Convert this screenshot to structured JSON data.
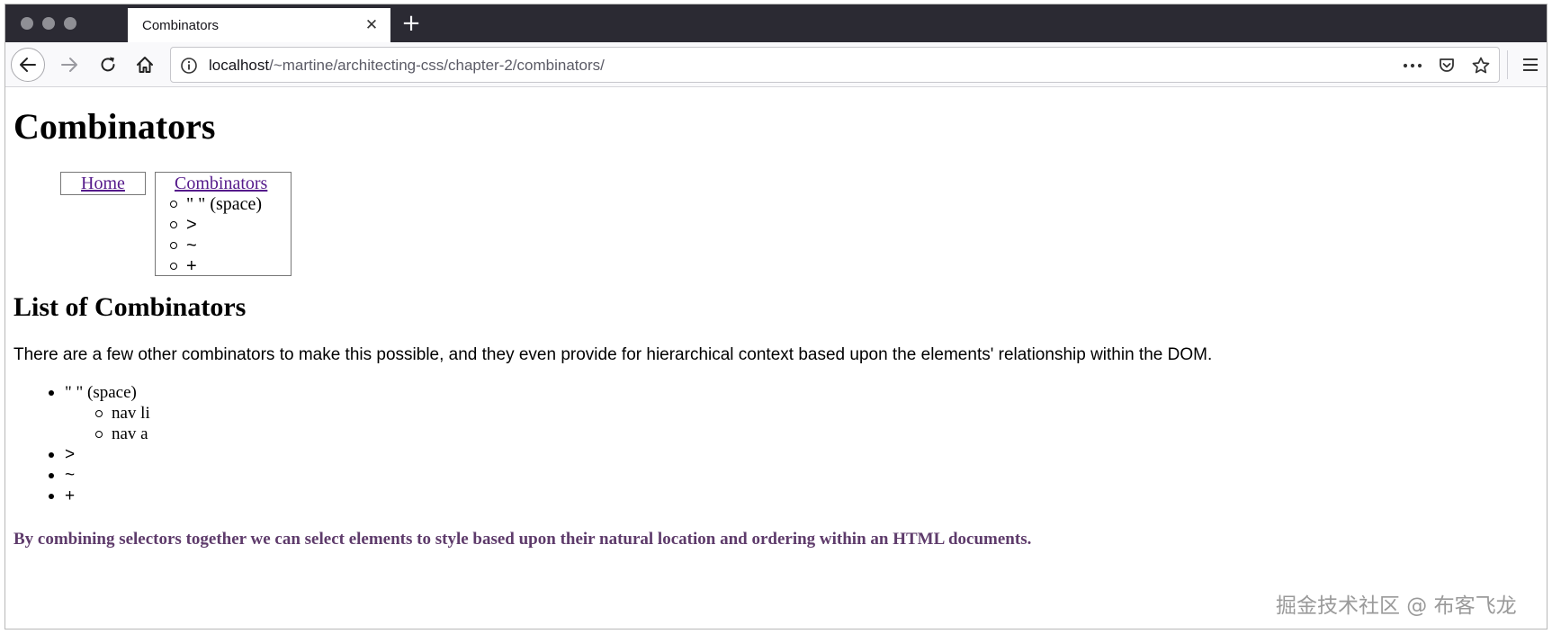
{
  "browser": {
    "tab_title": "Combinators",
    "url_host": "localhost",
    "url_path": "/~martine/architecting-css/chapter-2/combinators/"
  },
  "icons": [
    "back-arrow-icon",
    "forward-arrow-icon",
    "reload-icon",
    "home-icon",
    "info-icon",
    "more-dots-icon",
    "pocket-icon",
    "bookmark-star-icon",
    "hamburger-menu-icon",
    "close-icon",
    "plus-icon"
  ],
  "page": {
    "heading": "Combinators",
    "nav": {
      "home_label": "Home",
      "combinators_label": "Combinators",
      "sub_items": [
        "\" \" (space)",
        ">",
        "~",
        "+"
      ]
    },
    "list_heading": "List of Combinators",
    "intro": "There are a few other combinators to make this possible, and they even provide for hierarchical context based upon the elements' relationship within the DOM.",
    "list": {
      "item1": "\" \" (space)",
      "item1_children": [
        "nav li",
        "nav a"
      ],
      "item2": ">",
      "item3": "~",
      "item4": "+"
    },
    "note": "By combining selectors together we can select elements to style based upon their natural location and ordering within an HTML documents."
  },
  "watermark": "掘金技术社区 @ 布客飞龙"
}
